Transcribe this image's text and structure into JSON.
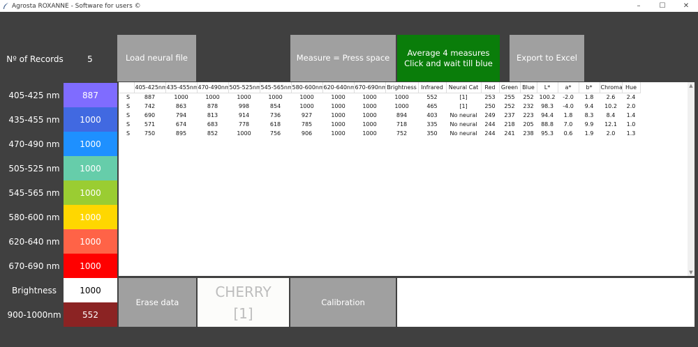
{
  "window": {
    "title": "Agrosta ROXANNE - Software for users ©",
    "minimize": "–",
    "maximize": "☐",
    "close": "✕"
  },
  "records": {
    "label": "Nº of Records",
    "count": "5"
  },
  "buttons": {
    "load": "Load neural file",
    "measure": "Measure = Press space",
    "average_line1": "Average 4 measures",
    "average_line2": "Click and wait till blue",
    "export": "Export to Excel",
    "erase": "Erase data",
    "calibration": "Calibration"
  },
  "bands": [
    {
      "label": "405-425 nm",
      "value": "887",
      "color": "#7f6cff"
    },
    {
      "label": "435-455 nm",
      "value": "1000",
      "color": "#4169e1"
    },
    {
      "label": "470-490 nm",
      "value": "1000",
      "color": "#1e90ff"
    },
    {
      "label": "505-525 nm",
      "value": "1000",
      "color": "#66cdaa"
    },
    {
      "label": "545-565 nm",
      "value": "1000",
      "color": "#9acd32"
    },
    {
      "label": "580-600 nm",
      "value": "1000",
      "color": "#ffd700"
    },
    {
      "label": "620-640 nm",
      "value": "1000",
      "color": "#ff6347"
    },
    {
      "label": "670-690 nm",
      "value": "1000",
      "color": "#ff0000"
    },
    {
      "label": "Brightness",
      "value": "1000",
      "color": "#ffffff"
    },
    {
      "label": "900-1000nm",
      "value": "552",
      "color": "#8b2323"
    }
  ],
  "result": {
    "name": "CHERRY",
    "category": "[1]"
  },
  "table": {
    "columns": [
      "",
      "405-425nm",
      "435-455nm",
      "470-490nm",
      "505-525nm",
      "545-565nm",
      "580-600nm",
      "620-640nm",
      "670-690nm",
      "Brightness",
      "Infrared",
      "Neural Cat",
      "Red",
      "Green",
      "Blue",
      "L*",
      "a*",
      "b*",
      "Chroma",
      "Hue"
    ],
    "rows": [
      [
        "S",
        "887",
        "1000",
        "1000",
        "1000",
        "1000",
        "1000",
        "1000",
        "1000",
        "1000",
        "552",
        "[1]",
        "253",
        "255",
        "252",
        "100.2",
        "-2.0",
        "1.8",
        "2.6",
        "2.4"
      ],
      [
        "S",
        "742",
        "863",
        "878",
        "998",
        "854",
        "1000",
        "1000",
        "1000",
        "1000",
        "465",
        "[1]",
        "250",
        "252",
        "232",
        "98.3",
        "-4.0",
        "9.4",
        "10.2",
        "2.0"
      ],
      [
        "S",
        "690",
        "794",
        "813",
        "914",
        "736",
        "927",
        "1000",
        "1000",
        "894",
        "403",
        "No neural",
        "249",
        "237",
        "223",
        "94.4",
        "1.8",
        "8.3",
        "8.4",
        "1.4"
      ],
      [
        "S",
        "571",
        "674",
        "683",
        "778",
        "618",
        "785",
        "1000",
        "1000",
        "718",
        "335",
        "No neural",
        "244",
        "218",
        "205",
        "88.8",
        "7.0",
        "9.9",
        "12.1",
        "1.0"
      ],
      [
        "S",
        "750",
        "895",
        "852",
        "1000",
        "756",
        "906",
        "1000",
        "1000",
        "752",
        "350",
        "No neural",
        "244",
        "241",
        "238",
        "95.3",
        "0.6",
        "1.9",
        "2.0",
        "1.3"
      ]
    ]
  }
}
